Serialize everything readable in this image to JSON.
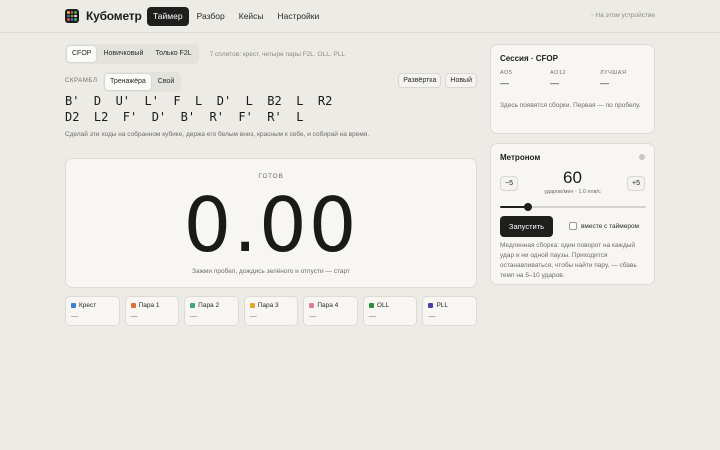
{
  "app": {
    "name": "Кубометр",
    "device_note": "◦ На этом устройстве",
    "logo_colors": [
      "#e9a23b",
      "#d9533a",
      "#3b9f5c",
      "#3f7dd0",
      "#e9c43b",
      "#f2f2ee",
      "#d9533a",
      "#3f7dd0",
      "#3b9f5c"
    ]
  },
  "nav": [
    {
      "label": "Таймер",
      "active": true
    },
    {
      "label": "Разбор",
      "active": false
    },
    {
      "label": "Кейсы",
      "active": false
    },
    {
      "label": "Настройки",
      "active": false
    }
  ],
  "modes": {
    "items": [
      {
        "label": "CFOP",
        "active": true
      },
      {
        "label": "Новичковый",
        "active": false
      },
      {
        "label": "Только F2L",
        "active": false
      }
    ],
    "description": "7 сплитов: крест, четыре пары F2L, OLL, PLL"
  },
  "scramble": {
    "label": "СКРАМБЛ",
    "source_options": [
      {
        "label": "Тренажёра",
        "active": true
      },
      {
        "label": "Свой",
        "active": false
      }
    ],
    "net_button": "Развёртка",
    "new_button": "Новый",
    "line1": "B'  D  U'  L'  F  L  D'  L  B2  L  R2",
    "line2": "D2  L2  F'  D'  B'  R'  F'  R'  L",
    "hint": "Сделай эти ходы на собранном кубике, держа его белым вниз, красным к себе, и собирай на время."
  },
  "timer": {
    "status": "ГОТОВ",
    "value": "0.00",
    "hint": "Зажми пробел, дождись зелёного и отпусти — старт"
  },
  "splits": [
    {
      "label": "Крест",
      "color": "#3f7dd0",
      "value": "—"
    },
    {
      "label": "Пара 1",
      "color": "#d9733a",
      "value": "—"
    },
    {
      "label": "Пара 2",
      "color": "#3aa58a",
      "value": "—"
    },
    {
      "label": "Пара 3",
      "color": "#e0a82b",
      "value": "—"
    },
    {
      "label": "Пара 4",
      "color": "#e07aa0",
      "value": "—"
    },
    {
      "label": "OLL",
      "color": "#2f8f3e",
      "value": "—"
    },
    {
      "label": "PLL",
      "color": "#4b3fa0",
      "value": "—"
    }
  ],
  "session": {
    "title": "Сессия · CFOP",
    "stats": [
      {
        "label": "AO5",
        "value": "—"
      },
      {
        "label": "AO12",
        "value": "—"
      },
      {
        "label": "ЛУЧШАЯ",
        "value": "—"
      }
    ],
    "empty": "Здесь появятся сборки. Первая — по пробелу."
  },
  "metronome": {
    "title": "Метроном",
    "minus": "−5",
    "plus": "+5",
    "bpm": "60",
    "unit": "ударов/мин · 1.0 пов/с",
    "slider_fraction": 0.19,
    "start": "Запустить",
    "with_timer": "вместе с таймером",
    "description": "Медленная сборка: один поворот на каждый удар и ни одной паузы. Приходится останавливаться, чтобы найти пару, — сбавь темп на 5–10 ударов."
  }
}
